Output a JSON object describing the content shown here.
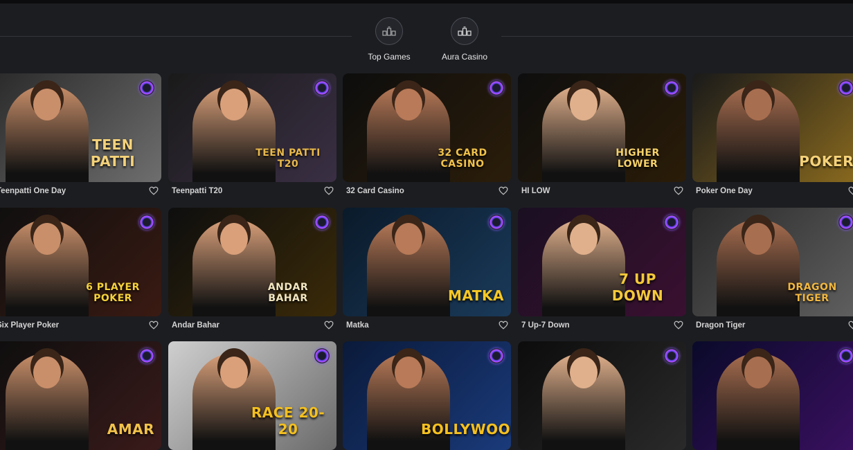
{
  "tabs": [
    {
      "label": "Top Games",
      "icon": "top-games-icon",
      "active": false
    },
    {
      "label": "Aura Casino",
      "icon": "aura-casino-icon",
      "active": true
    }
  ],
  "games": [
    {
      "title": "Teenpatti One Day",
      "logo": "TEEN PATTI",
      "bg": [
        "#2a2a2a",
        "#6e6e6e"
      ],
      "logo_color": "#f4d27a"
    },
    {
      "title": "Teenpatti T20",
      "logo": "TEEN PATTI T20",
      "bg": [
        "#1a1a1a",
        "#3a2f44"
      ],
      "logo_color": "#e8b84a"
    },
    {
      "title": "32 Card Casino",
      "logo": "32 CARD CASINO",
      "bg": [
        "#0d0d0d",
        "#2b1d0a"
      ],
      "logo_color": "#f1c24a"
    },
    {
      "title": "HI LOW",
      "logo": "HIGHER LOWER",
      "bg": [
        "#0e0e0e",
        "#2a1c08"
      ],
      "logo_color": "#f7d26a"
    },
    {
      "title": "Poker One Day",
      "logo": "POKER",
      "bg": [
        "#1a1a1a",
        "#8a6a1e"
      ],
      "logo_color": "#f5d27a"
    },
    {
      "title": "Six Player Poker",
      "logo": "6 PLAYER POKER",
      "bg": [
        "#0f0f0f",
        "#3a1a12"
      ],
      "logo_color": "#f6d23a"
    },
    {
      "title": "Andar Bahar",
      "logo": "ANDAR BAHAR",
      "bg": [
        "#0e0e0e",
        "#3a2a08"
      ],
      "logo_color": "#f2e7c0"
    },
    {
      "title": "Matka",
      "logo": "MATKA",
      "bg": [
        "#0a1a2a",
        "#1a3a5a"
      ],
      "logo_color": "#f7c824"
    },
    {
      "title": "7 Up-7 Down",
      "logo": "7 UP DOWN",
      "bg": [
        "#1a0f22",
        "#3a1030"
      ],
      "logo_color": "#f5c93a"
    },
    {
      "title": "Dragon Tiger",
      "logo": "DRAGON TIGER",
      "bg": [
        "#2a2a2a",
        "#606060"
      ],
      "logo_color": "#f2b840"
    },
    {
      "title": "",
      "logo": "AMAR",
      "bg": [
        "#0e0e0e",
        "#3a1a1a"
      ],
      "logo_color": "#f2c24a"
    },
    {
      "title": "",
      "logo": "RACE 20-20",
      "bg": [
        "#cfcfcf",
        "#6a6a6a"
      ],
      "logo_color": "#f4c020"
    },
    {
      "title": "",
      "logo": "BOLLYWOOD",
      "bg": [
        "#0a1a3a",
        "#1a3a7a"
      ],
      "logo_color": "#f5c020"
    },
    {
      "title": "",
      "logo": "",
      "bg": [
        "#0c0c0c",
        "#2a2a2a"
      ],
      "logo_color": "#f2c24a"
    },
    {
      "title": "",
      "logo": "",
      "bg": [
        "#0a0a2a",
        "#3a1060"
      ],
      "logo_color": "#f2c24a"
    }
  ],
  "colors": {
    "page_bg": "#1c1d21",
    "accent_badge": "#8a5cff",
    "dealer_tones": [
      "#c98f6a",
      "#d9a07a",
      "#b87a58",
      "#e0b08c",
      "#a86e50"
    ]
  }
}
